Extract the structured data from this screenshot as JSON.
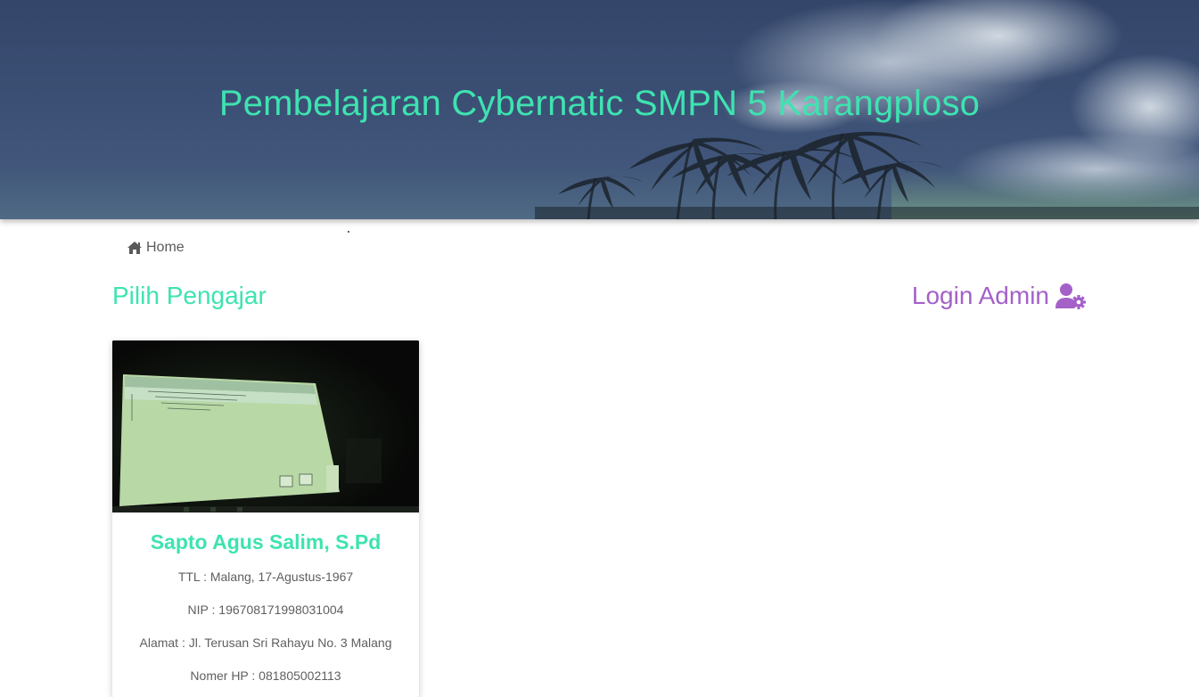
{
  "header": {
    "title": "Pembelajaran Cybernatic SMPN 5 Karangploso"
  },
  "breadcrumb": {
    "icon": "home-icon",
    "label": "Home"
  },
  "section": {
    "title": "Pilih Pengajar"
  },
  "login": {
    "label": "Login Admin",
    "icon": "user-gear-icon"
  },
  "teachers": [
    {
      "name": "Sapto Agus Salim, S.Pd",
      "ttl": "TTL : Malang, 17-Agustus-1967",
      "nip": "NIP : 196708171998031004",
      "alamat": "Alamat : Jl. Terusan Sri Rahayu No. 3 Malang",
      "hp": "Nomer HP : 081805002113"
    }
  ],
  "colors": {
    "accent_green": "#3ee3b0",
    "accent_purple": "#a461c8",
    "hero_blue": "#3b4f74"
  }
}
